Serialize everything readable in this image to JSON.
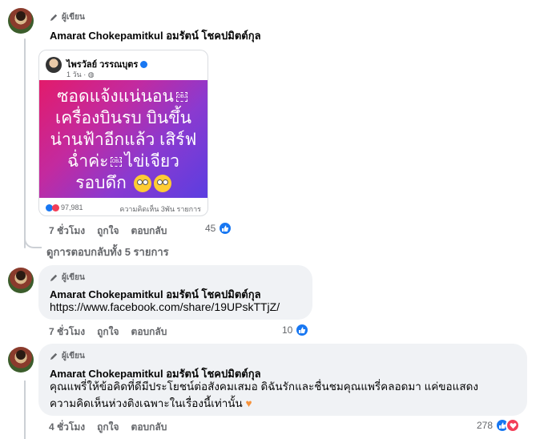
{
  "colors": {
    "accent": "#1877f2",
    "love": "#f33e58",
    "bubble_bg": "#f0f2f5",
    "muted": "#65676b",
    "post_gradient": [
      "#e21b6b",
      "#5b3ee0"
    ]
  },
  "comments": [
    {
      "author_tag": "ผู้เขียน",
      "name": "Amarat Chokepamitkul อมรัตน์ โชคปมิตต์กุล",
      "shared_post": {
        "page_name": "ไพรวัลย์ วรรณบุตร",
        "time": "1 วัน ·",
        "image_lines": [
          "ซอดแจ้งแน่นอน",
          "เครื่องบินรบ บินขึ้น",
          "น่านฟ้าอีกแล้ว เสิร์ฟ",
          "ฉ่ำค่ะ",
          "ไข่เจียว",
          "รอบดึก"
        ],
        "obj_label": "OBJ",
        "reaction_count": "97,981",
        "comments_shares": "ความคิดเห็น 3พัน รายการ"
      },
      "time": "7 ชั่วโมง",
      "like_label": "ถูกใจ",
      "reply_label": "ตอบกลับ",
      "reaction_count": "45",
      "view_replies": "ดูการตอบกลับทั้ง 5 รายการ"
    },
    {
      "author_tag": "ผู้เขียน",
      "name": "Amarat Chokepamitkul อมรัตน์ โชคปมิตต์กุล",
      "text": "https://www.facebook.com/share/19UPskTTjZ/",
      "time": "7 ชั่วโมง",
      "like_label": "ถูกใจ",
      "reply_label": "ตอบกลับ",
      "reaction_count": "10"
    },
    {
      "author_tag": "ผู้เขียน",
      "name": "Amarat Chokepamitkul อมรัตน์ โชคปมิตต์กุล",
      "text_line1": "คุณแพรี่ให้ข้อคิดที่ดีมีประโยชน์ต่อสังคมเสมอ ดิฉันรักและชื่นชมคุณแพรี่คลอดมา แค่ขอแสดง",
      "text_line2": "ความคิดเห็นห่วงติงเฉพาะในเรื่องนี้เท่านั้น",
      "time": "4 ชั่วโมง",
      "like_label": "ถูกใจ",
      "reply_label": "ตอบกลับ",
      "reaction_count": "278"
    }
  ]
}
